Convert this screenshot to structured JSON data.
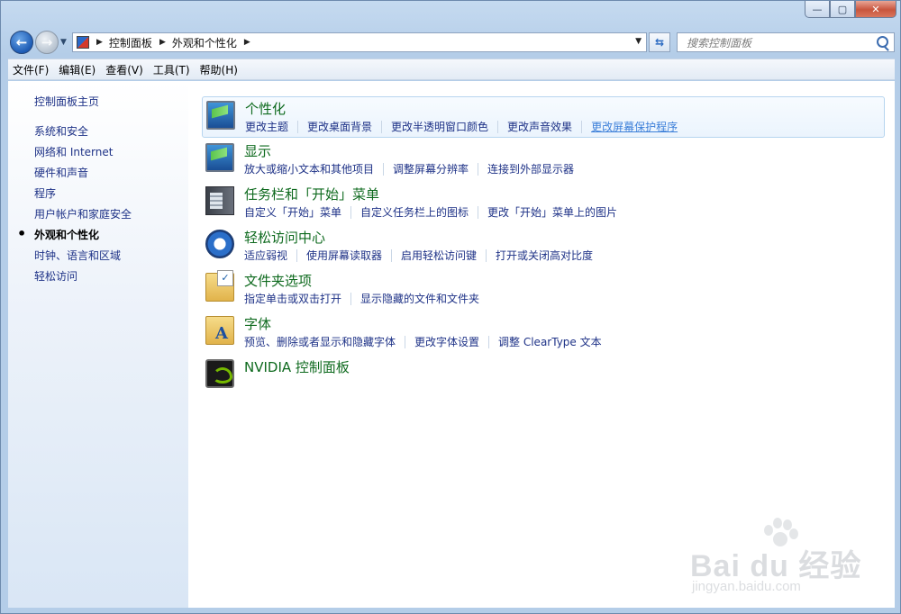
{
  "window": {
    "controls": {
      "minimize": "—",
      "maximize": "▢",
      "close": "✕"
    }
  },
  "address": {
    "crumbs": [
      "控制面板",
      "外观和个性化"
    ]
  },
  "search": {
    "placeholder": "搜索控制面板"
  },
  "menu": [
    "文件(F)",
    "编辑(E)",
    "查看(V)",
    "工具(T)",
    "帮助(H)"
  ],
  "sidebar": {
    "home": "控制面板主页",
    "items": [
      "系统和安全",
      "网络和 Internet",
      "硬件和声音",
      "程序",
      "用户帐户和家庭安全",
      "外观和个性化",
      "时钟、语言和区域",
      "轻松访问"
    ],
    "active_index": 5
  },
  "categories": [
    {
      "title": "个性化",
      "icon": "personalization-monitor-icon",
      "links": [
        "更改主题",
        "更改桌面背景",
        "更改半透明窗口颜色",
        "更改声音效果",
        "更改屏幕保护程序"
      ]
    },
    {
      "title": "显示",
      "icon": "display-monitor-icon",
      "links": [
        "放大或缩小文本和其他项目",
        "调整屏幕分辨率",
        "连接到外部显示器"
      ]
    },
    {
      "title": "任务栏和「开始」菜单",
      "icon": "taskbar-icon",
      "links": [
        "自定义「开始」菜单",
        "自定义任务栏上的图标",
        "更改「开始」菜单上的图片"
      ]
    },
    {
      "title": "轻松访问中心",
      "icon": "ease-of-access-icon",
      "links": [
        "适应弱视",
        "使用屏幕读取器",
        "启用轻松访问键",
        "打开或关闭高对比度"
      ]
    },
    {
      "title": "文件夹选项",
      "icon": "folder-options-icon",
      "links": [
        "指定单击或双击打开",
        "显示隐藏的文件和文件夹"
      ]
    },
    {
      "title": "字体",
      "icon": "fonts-folder-icon",
      "links": [
        "预览、删除或者显示和隐藏字体",
        "更改字体设置",
        "调整 ClearType 文本"
      ]
    },
    {
      "title": "NVIDIA 控制面板",
      "icon": "nvidia-icon",
      "links": []
    }
  ],
  "watermark": {
    "logo": "Bai du 经验",
    "url": "jingyan.baidu.com"
  },
  "colors": {
    "link": "#1e3287",
    "category_title": "#0e6a1e",
    "hover_link": "#3c7fd9"
  }
}
